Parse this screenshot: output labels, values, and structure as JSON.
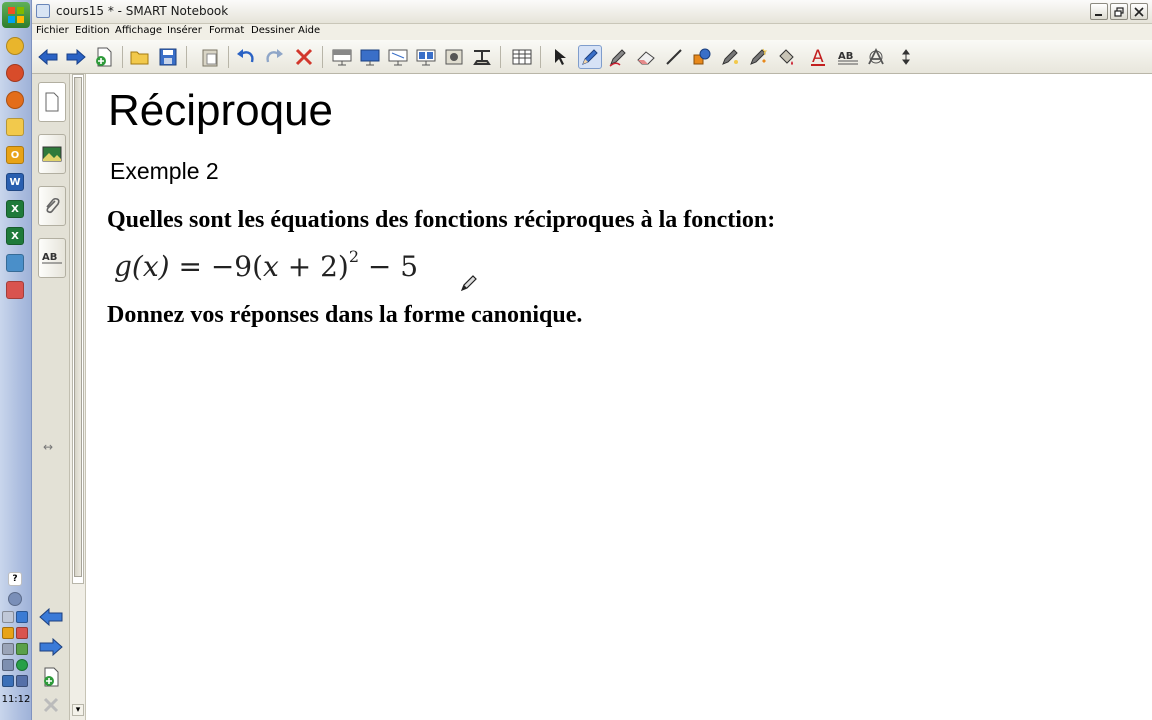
{
  "window": {
    "title": "cours15 * - SMART Notebook"
  },
  "menu": [
    "Fichier",
    "Edition",
    "Affichage",
    "Insérer",
    "Format",
    "Dessiner",
    "Aide"
  ],
  "toolbar": {
    "tools": [
      "back-icon",
      "forward-icon",
      "add-page-icon",
      "open-folder-icon",
      "save-icon",
      "paste-icon",
      "undo-icon",
      "redo-icon",
      "delete-icon",
      "screen-shade-icon",
      "full-screen-icon",
      "dual-page-icon",
      "capture-icon",
      "document-camera-icon",
      "text-format-icon",
      "table-icon",
      "select-icon",
      "pen-icon",
      "creative-pen-icon",
      "eraser-icon",
      "line-icon",
      "shapes-icon",
      "magic-pen-icon",
      "shape-recognition-pen-icon",
      "fill-icon",
      "text-icon",
      "properties-icon",
      "measurement-icon",
      "toolbar-position-icon"
    ],
    "active_tool": "pen-icon"
  },
  "side_panel": {
    "tabs": [
      "page-sorter-icon",
      "gallery-icon",
      "attachments-icon",
      "properties-icon"
    ]
  },
  "page": {
    "heading": "Réciproque",
    "subheading": "Exemple 2",
    "question": "Quelles sont les équations des fonctions réciproques à la fonction:",
    "equation": {
      "lhs": "g(x)",
      "equals": "=",
      "rhs_prefix": "−9(",
      "rhs_var": "x",
      "rhs_middle": " + 2)",
      "exponent": "2",
      "rhs_suffix": " − 5"
    },
    "instruction": "Donnez vos réponses dans la forme canonique."
  },
  "taskbar": {
    "clock": "11:12"
  },
  "colors": {
    "taskbar": "#aebfe0",
    "toolbar": "#f0eee6",
    "canvas": "#ffffff",
    "accent_blue": "#2a5fb0"
  }
}
